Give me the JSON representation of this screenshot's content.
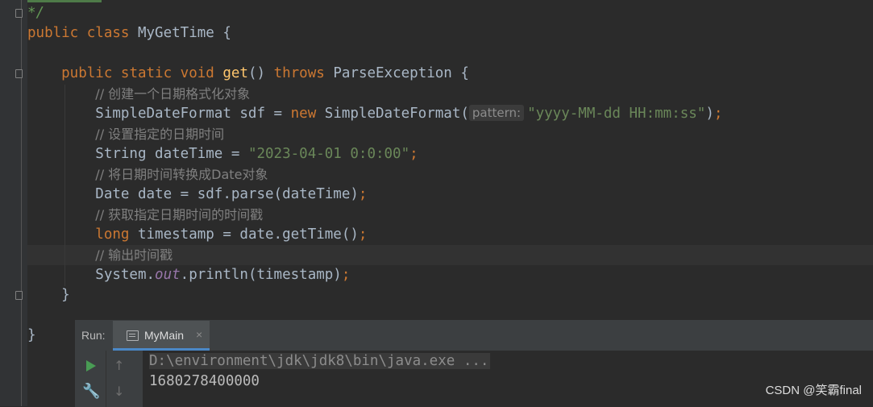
{
  "editor": {
    "lines": [
      [
        {
          "t": "*/",
          "c": "cmt"
        }
      ],
      [
        {
          "t": "public ",
          "c": "k"
        },
        {
          "t": "class ",
          "c": "k"
        },
        {
          "t": "MyGetTime {"
        }
      ],
      [],
      [
        {
          "t": "    public ",
          "c": "k"
        },
        {
          "t": "static ",
          "c": "k"
        },
        {
          "t": "void ",
          "c": "k"
        },
        {
          "t": "get",
          "c": "fn"
        },
        {
          "t": "() "
        },
        {
          "t": "throws ",
          "c": "k"
        },
        {
          "t": "ParseException {"
        }
      ],
      [
        {
          "t": "        "
        },
        {
          "t": "// 创建一个日期格式化对象",
          "c": "c"
        }
      ],
      [
        {
          "t": "        SimpleDateFormat sdf = "
        },
        {
          "t": "new ",
          "c": "k"
        },
        {
          "t": "SimpleDateFormat("
        },
        {
          "t": "pattern:",
          "c": "hint"
        },
        {
          "t": "\"yyyy-MM-dd HH:mm:ss\"",
          "c": "s"
        },
        {
          "t": ")"
        },
        {
          "t": ";",
          "c": "k"
        }
      ],
      [
        {
          "t": "        "
        },
        {
          "t": "// 设置指定的日期时间",
          "c": "c"
        }
      ],
      [
        {
          "t": "        String dateTime = "
        },
        {
          "t": "\"2023-04-01 0:0:00\"",
          "c": "s"
        },
        {
          "t": ";",
          "c": "k"
        }
      ],
      [
        {
          "t": "        "
        },
        {
          "t": "// 将日期时间转换成Date对象",
          "c": "c"
        }
      ],
      [
        {
          "t": "        Date date = sdf.parse(dateTime)"
        },
        {
          "t": ";",
          "c": "k"
        }
      ],
      [
        {
          "t": "        "
        },
        {
          "t": "// 获取指定日期时间的时间戳",
          "c": "c"
        }
      ],
      [
        {
          "t": "        "
        },
        {
          "t": "long ",
          "c": "k"
        },
        {
          "t": "timestamp = date.getTime()"
        },
        {
          "t": ";",
          "c": "k"
        }
      ],
      [
        {
          "t": "        "
        },
        {
          "t": "// 输出时间戳",
          "c": "c"
        }
      ],
      [
        {
          "t": "        System."
        },
        {
          "t": "out",
          "c": "st"
        },
        {
          "t": ".println(timestamp)"
        },
        {
          "t": ";",
          "c": "k"
        }
      ],
      [
        {
          "t": "    }"
        }
      ],
      [],
      [
        {
          "t": "}"
        }
      ]
    ]
  },
  "run_panel": {
    "label": "Run:",
    "tab_label": "MyMain",
    "tab_close": "×",
    "console": {
      "command": "D:\\environment\\jdk\\jdk8\\bin\\java.exe ...",
      "output": "1680278400000"
    },
    "icons": [
      "run-icon",
      "wrench-icon",
      "scroll-up-icon",
      "scroll-down-icon"
    ]
  },
  "watermark": "CSDN @笑霸final",
  "colors": {
    "background": "#2b2b2b",
    "keyword": "#cc7832",
    "string": "#6a8759",
    "method": "#ffc66d",
    "comment": "#808080",
    "accent": "#4a88c7"
  }
}
